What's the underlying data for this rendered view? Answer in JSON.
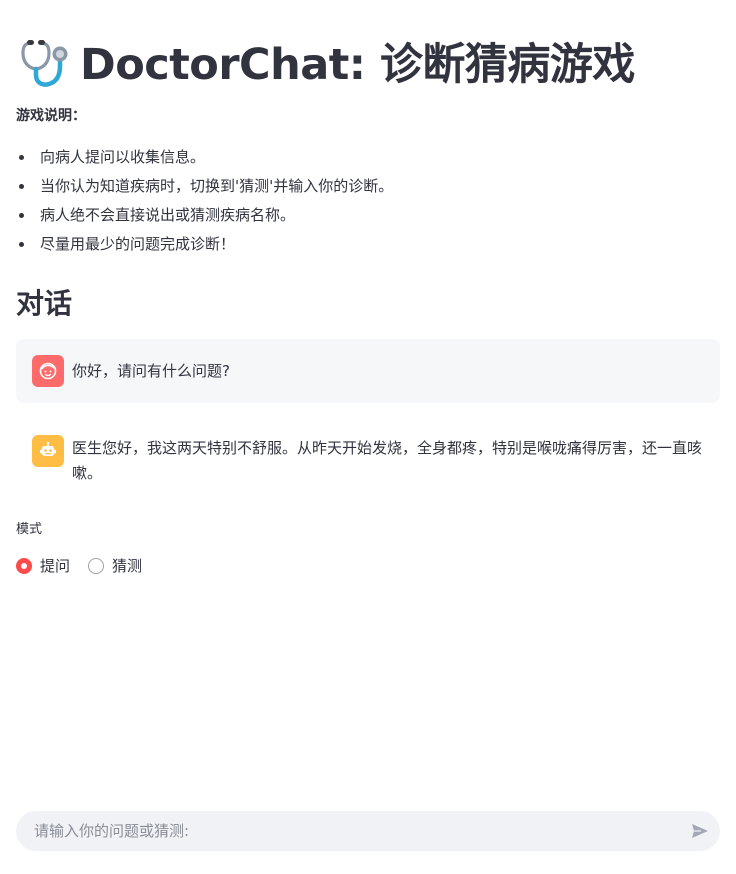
{
  "header": {
    "title_icon": "stethoscope-icon",
    "title": "DoctorChat: 诊断猜病游戏"
  },
  "rules": {
    "heading": "游戏说明：",
    "items": [
      "向病人提问以收集信息。",
      "当你认为知道疾病时，切换到'猜测'并输入你的诊断。",
      "病人绝不会直接说出或猜测疾病名称。",
      "尽量用最少的问题完成诊断！"
    ]
  },
  "conversation": {
    "title": "对话",
    "messages": [
      {
        "role": "assistant",
        "avatar_icon": "doctor-face-icon",
        "text": "你好，请问有什么问题?"
      },
      {
        "role": "user",
        "avatar_icon": "robot-icon",
        "text": "医生您好，我这两天特别不舒服。从昨天开始发烧，全身都疼，特别是喉咙痛得厉害，还一直咳嗽。"
      }
    ]
  },
  "mode": {
    "label": "模式",
    "options": [
      "提问",
      "猜测"
    ],
    "selected": "提问"
  },
  "chat_input": {
    "placeholder": "请输入你的问题或猜测:",
    "value": "",
    "send_icon": "send-icon"
  },
  "colors": {
    "accent": "#ff4b4b",
    "assistant_avatar": "#ff6b6b",
    "user_avatar": "#ffbd45",
    "text": "#31333f",
    "input_bg": "#f0f2f6"
  }
}
